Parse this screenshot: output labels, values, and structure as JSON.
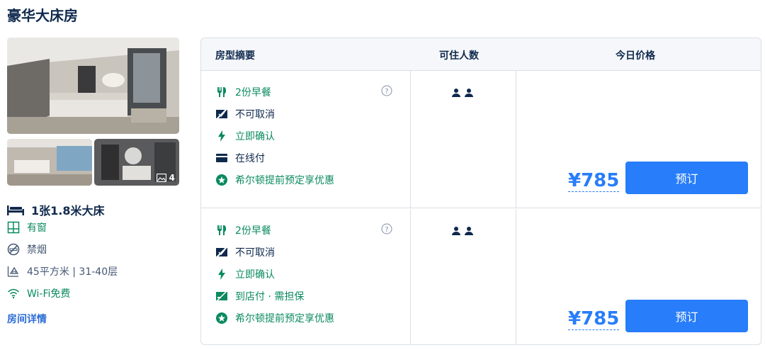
{
  "room": {
    "title": "豪华大床房",
    "photo_count": "4",
    "bed": "1张1.8米大床",
    "features": {
      "window": "有窗",
      "smoking": "禁烟",
      "area": "45平方米 | 31-40层",
      "wifi": "Wi-Fi免费"
    },
    "detail_link": "房间详情"
  },
  "table": {
    "headers": {
      "summary": "房型摘要",
      "occupancy": "可住人数",
      "price": "今日价格"
    },
    "offers": [
      {
        "breakfast": "2份早餐",
        "cancel": "不可取消",
        "confirm": "立即确认",
        "payment": "在线付",
        "promo": "希尔顿提前预定享优惠",
        "price": "¥785",
        "book_label": "预订"
      },
      {
        "breakfast": "2份早餐",
        "cancel": "不可取消",
        "confirm": "立即确认",
        "payment": "到店付 · 需担保",
        "promo": "希尔顿提前预定享优惠",
        "price": "¥785",
        "book_label": "预订"
      }
    ]
  },
  "colors": {
    "brand_blue": "#287dfa",
    "green": "#0a8a5f",
    "text_dark": "#0f294d"
  }
}
